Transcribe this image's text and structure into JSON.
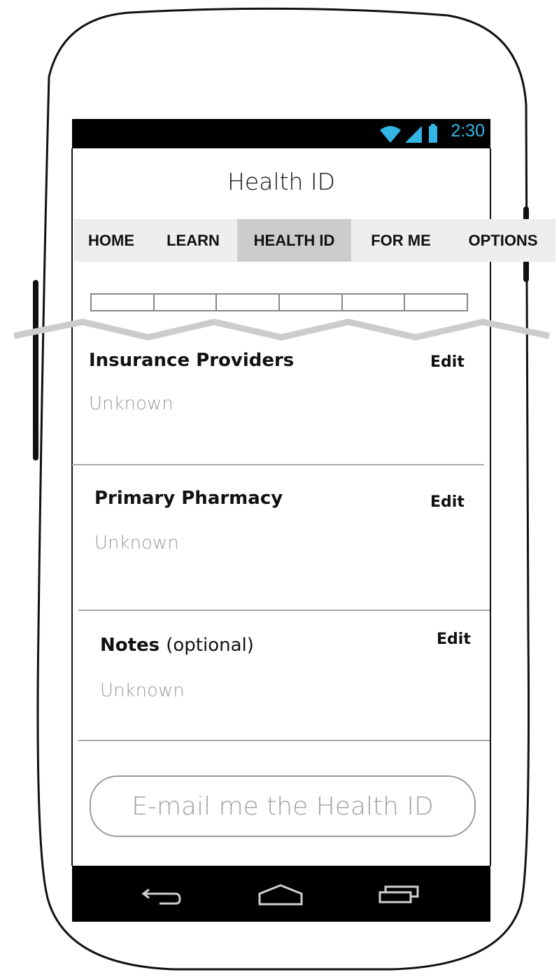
{
  "status_bar": {
    "time": "2:30",
    "accent_color": "#33b5e5"
  },
  "header": {
    "title": "Health ID"
  },
  "tabs": [
    {
      "label": "HOME",
      "active": false
    },
    {
      "label": "LEARN",
      "active": false
    },
    {
      "label": "HEALTH ID",
      "active": true
    },
    {
      "label": "FOR ME",
      "active": false
    },
    {
      "label": "OPTIONS",
      "active": false
    }
  ],
  "progress": {
    "segments": 6
  },
  "sections": [
    {
      "title": "Insurance Providers",
      "edit_label": "Edit",
      "value": "Unknown"
    },
    {
      "title": "Primary Pharmacy",
      "edit_label": "Edit",
      "value": "Unknown"
    },
    {
      "title": "Notes",
      "title_suffix": "(optional)",
      "edit_label": "Edit",
      "value": "Unknown"
    }
  ],
  "email_button": {
    "label": "E-mail me the Health ID"
  },
  "nav": {
    "icons": [
      "back-icon",
      "home-icon",
      "recent-apps-icon"
    ]
  }
}
